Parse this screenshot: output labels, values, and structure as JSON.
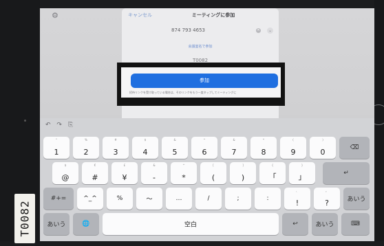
{
  "dialog": {
    "cancel_label": "キャンセル",
    "title": "ミーティングに参加",
    "meeting_id": "874 793 4653",
    "room_link": "会議室名で参加",
    "display_name": "T0082",
    "join_button": "参加",
    "notice": "招待リンクを受け取っている場合は、そのリンクをもう一度タップしてミーティングに"
  },
  "keyboard": {
    "toolbar": {
      "undo": "↶",
      "redo": "↷",
      "paste": "⎘"
    },
    "number_row": [
      {
        "main": "1",
        "sub": "°"
      },
      {
        "main": "2",
        "sub": "%"
      },
      {
        "main": "3",
        "sub": "#"
      },
      {
        "main": "4",
        "sub": "$"
      },
      {
        "main": "5",
        "sub": "&"
      },
      {
        "main": "6",
        "sub": "^"
      },
      {
        "main": "7",
        "sub": "&"
      },
      {
        "main": "8",
        "sub": "*"
      },
      {
        "main": "9",
        "sub": "("
      },
      {
        "main": "0",
        "sub": ")"
      }
    ],
    "delete_key": "⌫",
    "symbol_row": [
      {
        "main": "@",
        "sub": "$"
      },
      {
        "main": "#",
        "sub": "€"
      },
      {
        "main": "¥",
        "sub": "£"
      },
      {
        "main": "-",
        "sub": "&"
      },
      {
        "main": "*",
        "sub": "^"
      },
      {
        "main": "(",
        "sub": "["
      },
      {
        "main": ")",
        "sub": "]"
      },
      {
        "main": "「",
        "sub": "{"
      },
      {
        "main": "」",
        "sub": "}"
      }
    ],
    "return_key": "↵",
    "punct_row": [
      {
        "main": "^_^",
        "sub": ""
      },
      {
        "main": "%",
        "sub": ""
      },
      {
        "main": "〜",
        "sub": ""
      },
      {
        "main": "…",
        "sub": ""
      },
      {
        "main": "/",
        "sub": ""
      },
      {
        "main": ";",
        "sub": ""
      },
      {
        "main": ":",
        "sub": ""
      },
      {
        "main": "!",
        "sub": "、"
      },
      {
        "main": "?",
        "sub": "。"
      }
    ],
    "shift_left": "#+=",
    "shift_right": "あいう",
    "bottom_row": {
      "lang_left": "あいう",
      "globe": "🌐",
      "space": "空白",
      "undo_key": "↩",
      "lang_right": "あいう",
      "hide_keyboard": "⌨"
    }
  },
  "background": {
    "settings_icon": "⚙"
  },
  "tag_label": "T0082"
}
